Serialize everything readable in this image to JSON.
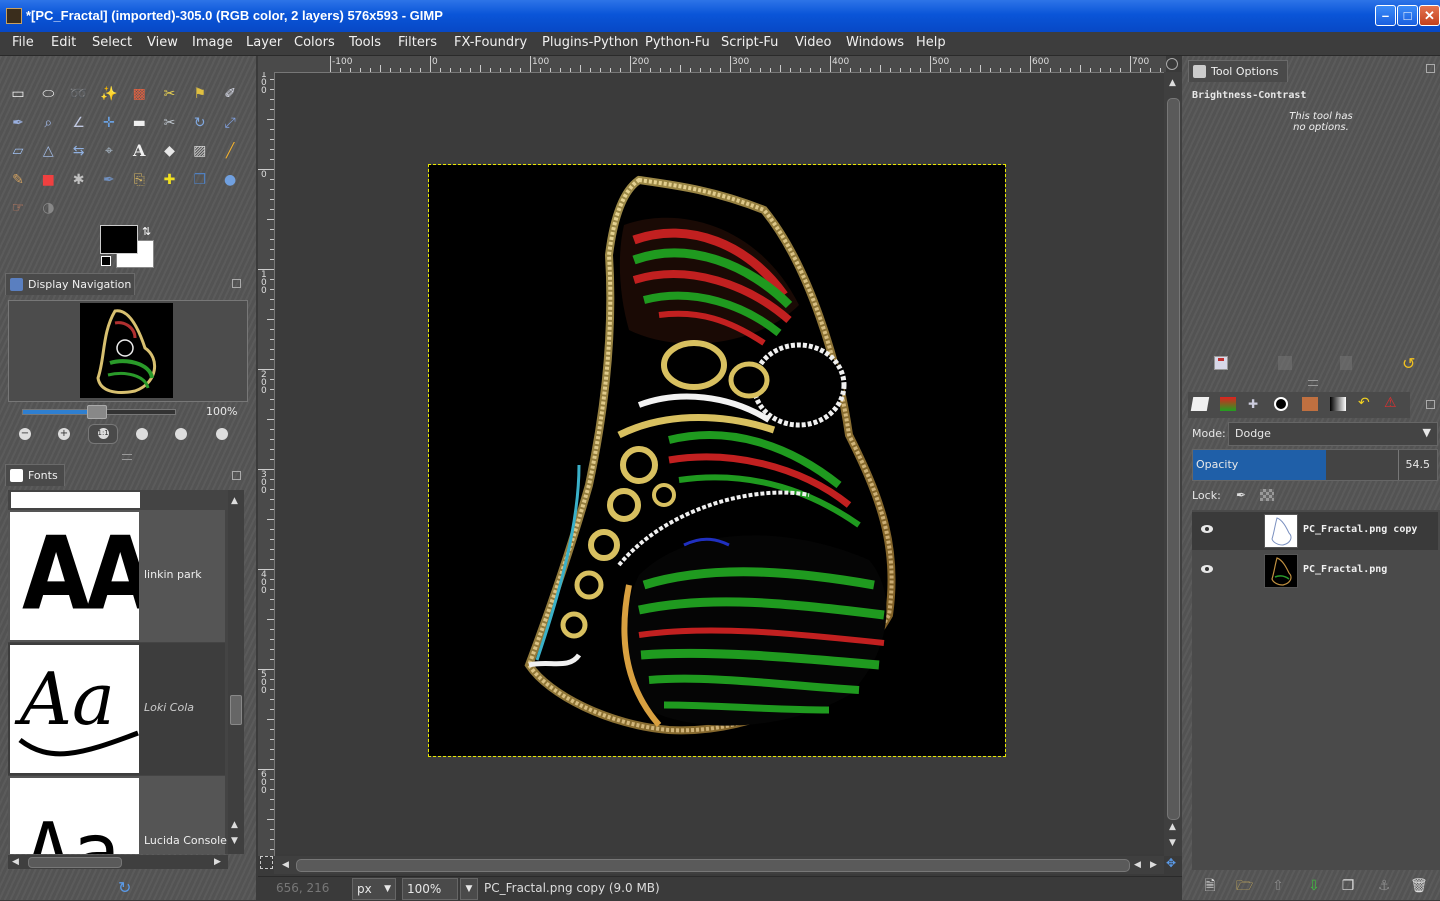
{
  "window": {
    "title": "*[PC_Fractal] (imported)-305.0 (RGB color, 2 layers) 576x593 - GIMP",
    "buttons": {
      "minimize": "–",
      "maximize": "□",
      "close": "✕"
    }
  },
  "menubar": [
    "File",
    "Edit",
    "Select",
    "View",
    "Image",
    "Layer",
    "Colors",
    "Tools",
    "Filters",
    "FX-Foundry",
    "Plugins-Python",
    "Python-Fu",
    "Script-Fu",
    "Video",
    "Windows",
    "Help"
  ],
  "toolbox": {
    "icons": [
      "rect-select-icon",
      "ellipse-select-icon",
      "free-select-icon",
      "fuzzy-select-icon",
      "select-by-color-icon",
      "scissors-select-icon",
      "foreground-select-icon",
      "paths-icon",
      "color-picker-icon",
      "zoom-icon",
      "measure-icon",
      "move-icon",
      "align-icon",
      "crop-icon",
      "rotate-icon",
      "scale-icon",
      "shear-icon",
      "perspective-icon",
      "flip-icon",
      "cage-icon",
      "text-icon",
      "bucket-fill-icon",
      "blend-icon",
      "pencil-icon",
      "paintbrush-icon",
      "eraser-icon",
      "airbrush-icon",
      "ink-icon",
      "clone-icon",
      "heal-icon",
      "perspective-clone-icon",
      "blur-icon",
      "smudge-icon",
      "dodge-burn-icon"
    ],
    "glyphs": [
      "▭",
      "⬭",
      "➿",
      "✨",
      "▩",
      "✂",
      "⚑",
      "✐",
      "✒",
      "⌕",
      "∠",
      "✛",
      "▬",
      "✂",
      "↻",
      "⤢",
      "▱",
      "△",
      "⇆",
      "⌖",
      "A",
      "◆",
      "▨",
      "╱",
      "✎",
      "■",
      "✱",
      "✒",
      "⎘",
      "✚",
      "❒",
      "●",
      "☞",
      "◑"
    ]
  },
  "navigation": {
    "tab_label": "Display Navigation",
    "zoom_level": "100%",
    "zoom_fraction": 0.48
  },
  "fonts_panel": {
    "tab_label": "Fonts",
    "items": [
      {
        "name": "linkin park",
        "sample": "AA"
      },
      {
        "name": "Loki Cola",
        "sample": "Aa"
      },
      {
        "name": "Lucida Console",
        "sample": "Aa"
      }
    ]
  },
  "canvas": {
    "hruler_labels": [
      "-100",
      "0",
      "100",
      "200",
      "300",
      "400",
      "500",
      "600",
      "700"
    ],
    "vruler_labels": [
      "100",
      "0",
      "100",
      "200",
      "300",
      "400",
      "500",
      "600"
    ]
  },
  "status": {
    "coords": "656, 216",
    "unit": "px",
    "zoom": "100",
    "zoom_suffix": "%",
    "message": "PC_Fractal.png copy (9.0 MB)"
  },
  "tool_options": {
    "tab_label": "Tool Options",
    "tool_name": "Brightness-Contrast",
    "message": "This tool has no options."
  },
  "layers": {
    "mode_label": "Mode:",
    "mode_value": "Dodge",
    "opacity_label": "Opacity",
    "opacity_value": "54.5",
    "opacity_fraction": 0.545,
    "lock_label": "Lock:",
    "items": [
      {
        "name": "PC_Fractal.png copy",
        "visible": true
      },
      {
        "name": "PC_Fractal.png",
        "visible": true
      }
    ]
  },
  "colors": {
    "accent": "#1f5fa8",
    "titlebar": "#0a55d8",
    "selection": "#e8e800"
  }
}
